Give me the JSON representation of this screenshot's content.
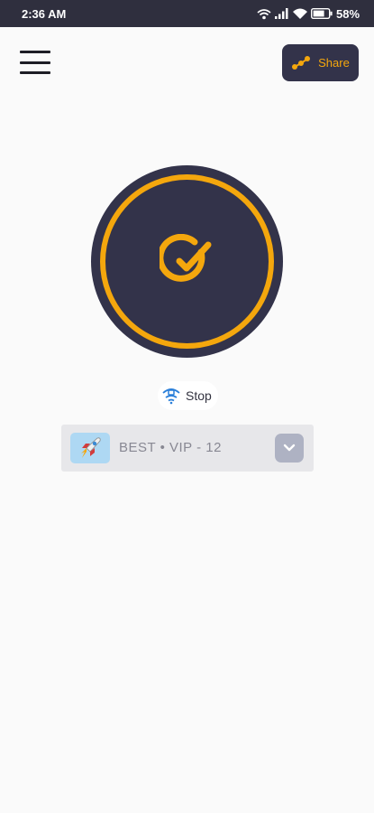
{
  "status_bar": {
    "time": "2:36 AM",
    "battery": "58"
  },
  "header": {
    "menu_icon": "hamburger-menu-icon",
    "share_label": "Share",
    "share_icon": "share-nodes-icon"
  },
  "connect_button": {
    "state_icon": "check-circle-icon",
    "accent_color": "#f4a70d",
    "background_color": "#33334a"
  },
  "stop": {
    "label": "Stop",
    "icon": "speed-signal-icon"
  },
  "server": {
    "flag_icon": "rocket-icon",
    "name": "BEST • VIP - 12",
    "dropdown_icon": "chevron-down-icon"
  }
}
